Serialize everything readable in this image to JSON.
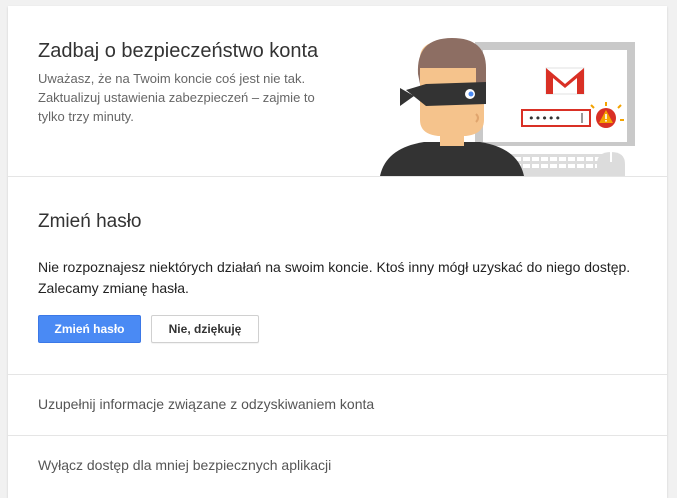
{
  "hero": {
    "title": "Zadbaj o bezpieczeństwo konta",
    "description": "Uważasz, że na Twoim koncie coś jest nie tak. Zaktualizuj ustawienia zabezpieczeń – zajmie to tylko trzy minuty."
  },
  "password_section": {
    "title": "Zmień hasło",
    "body": "Nie rozpoznajesz niektórych działań na swoim koncie. Ktoś inny mógł uzyskać do niego dostęp. Zalecamy zmianę hasła.",
    "primary_label": "Zmień hasło",
    "secondary_label": "Nie, dziękuję"
  },
  "links": [
    {
      "label": "Uzupełnij informacje związane z odzyskiwaniem konta"
    },
    {
      "label": "Wyłącz dostęp dla mniej bezpiecznych aplikacji"
    }
  ],
  "illustration": {
    "password_field": "•••••",
    "icons": [
      "burglar-icon",
      "gmail-logo-icon",
      "warning-icon",
      "keyboard-icon",
      "mouse-icon"
    ]
  },
  "colors": {
    "primary_button": "#4a8af4",
    "gmail_red": "#d93025",
    "warning_orange": "#f4a300"
  }
}
